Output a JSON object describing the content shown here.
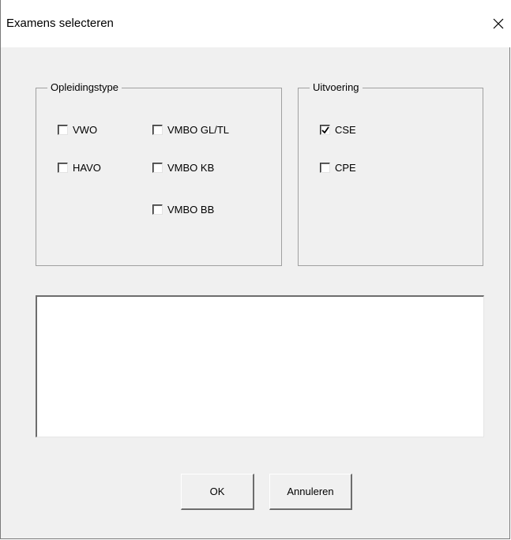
{
  "window": {
    "title": "Examens selecteren",
    "close_symbol": "✕",
    "close_icon": "close-icon"
  },
  "opleidingstype": {
    "legend": "Opleidingstype",
    "options": [
      {
        "label": "VWO",
        "checked": false
      },
      {
        "label": "HAVO",
        "checked": false
      },
      {
        "label": "VMBO GL/TL",
        "checked": false
      },
      {
        "label": "VMBO KB",
        "checked": false
      },
      {
        "label": "VMBO BB",
        "checked": false
      }
    ]
  },
  "uitvoering": {
    "legend": "Uitvoering",
    "options": [
      {
        "label": "CSE",
        "checked": true
      },
      {
        "label": "CPE",
        "checked": false
      }
    ]
  },
  "listbox": {
    "items": []
  },
  "buttons": {
    "ok_label": "OK",
    "cancel_label": "Annuleren"
  }
}
